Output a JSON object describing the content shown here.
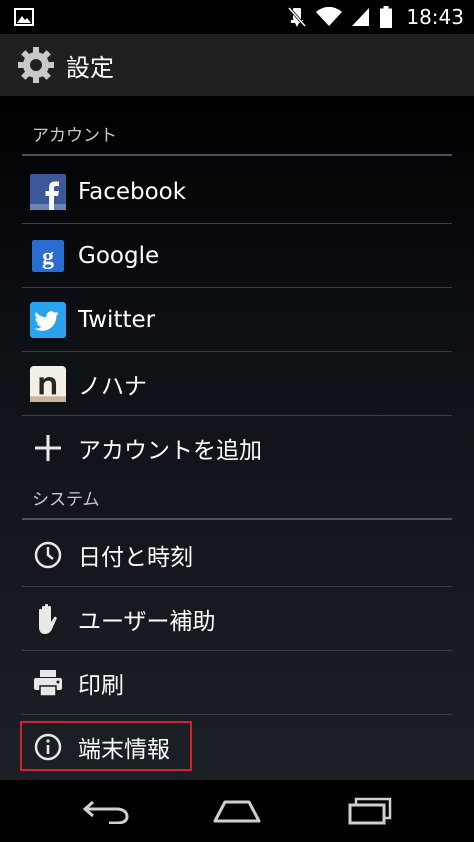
{
  "status_bar": {
    "time": "18:43",
    "icons": [
      "image-notification-icon",
      "mute-icon",
      "wifi-icon",
      "signal-icon",
      "battery-icon"
    ]
  },
  "action_bar": {
    "title": "設定",
    "icon": "gear-icon"
  },
  "sections": [
    {
      "header": "アカウント",
      "items": [
        {
          "label": "Facebook",
          "icon": "facebook-icon"
        },
        {
          "label": "Google",
          "icon": "google-icon"
        },
        {
          "label": "Twitter",
          "icon": "twitter-icon"
        },
        {
          "label": "ノハナ",
          "icon": "nohana-icon"
        },
        {
          "label": "アカウントを追加",
          "icon": "plus-icon"
        }
      ]
    },
    {
      "header": "システム",
      "items": [
        {
          "label": "日付と時刻",
          "icon": "clock-icon"
        },
        {
          "label": "ユーザー補助",
          "icon": "hand-icon"
        },
        {
          "label": "印刷",
          "icon": "printer-icon"
        },
        {
          "label": "端末情報",
          "icon": "info-icon"
        }
      ]
    }
  ],
  "nav_bar": {
    "buttons": [
      "back-icon",
      "home-icon",
      "recents-icon"
    ]
  },
  "colors": {
    "highlight": "#d3232a",
    "facebook": "#3b5998",
    "google": "#2a6dd2",
    "twitter": "#2aa3ef"
  }
}
